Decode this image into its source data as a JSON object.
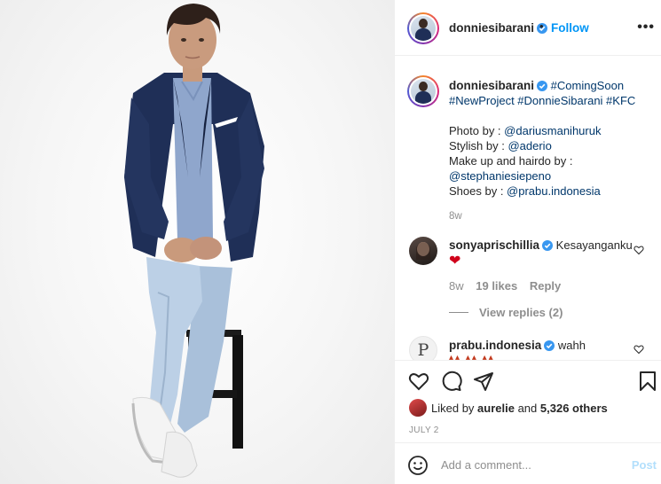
{
  "post": {
    "username": "donniesibarani",
    "dot": "•",
    "follow_label": "Follow",
    "more_icon": "more-horizontal-icon",
    "caption": {
      "username": "donniesibarani",
      "hashtags_line1": "#ComingSoon",
      "hashtags_line2": "#NewProject #DonnieSibarani #KFC",
      "credits": [
        {
          "label": "Photo by : ",
          "handle": "@dariusmanihuruk"
        },
        {
          "label": "Stylish by : ",
          "handle": "@aderio"
        },
        {
          "label": "Make up and hairdo by :",
          "handle": ""
        },
        {
          "label": "",
          "handle": "@stephaniesiepeno"
        },
        {
          "label": "Shoes by : ",
          "handle": "@prabu.indonesia"
        }
      ],
      "age": "8w"
    },
    "comments": [
      {
        "username": "sonyaprischillia",
        "text": "Kesayanganku",
        "emoji": "❤",
        "age": "8w",
        "likes": "19 likes",
        "reply": "Reply",
        "view_replies": "View replies (2)"
      },
      {
        "username": "prabu.indonesia",
        "text": "wahh",
        "avatar_letter": "P"
      }
    ],
    "likes_prefix": "Liked by ",
    "likes_user": "aurelie",
    "likes_middle": " and ",
    "likes_count": "5,326 others",
    "date": "JULY 2",
    "add_comment_placeholder": "Add a comment...",
    "post_label": "Post"
  },
  "colors": {
    "accent": "#0095f6",
    "hashtag": "#00376b",
    "muted": "#8e8e8e",
    "jacket": "#1f2f57"
  }
}
